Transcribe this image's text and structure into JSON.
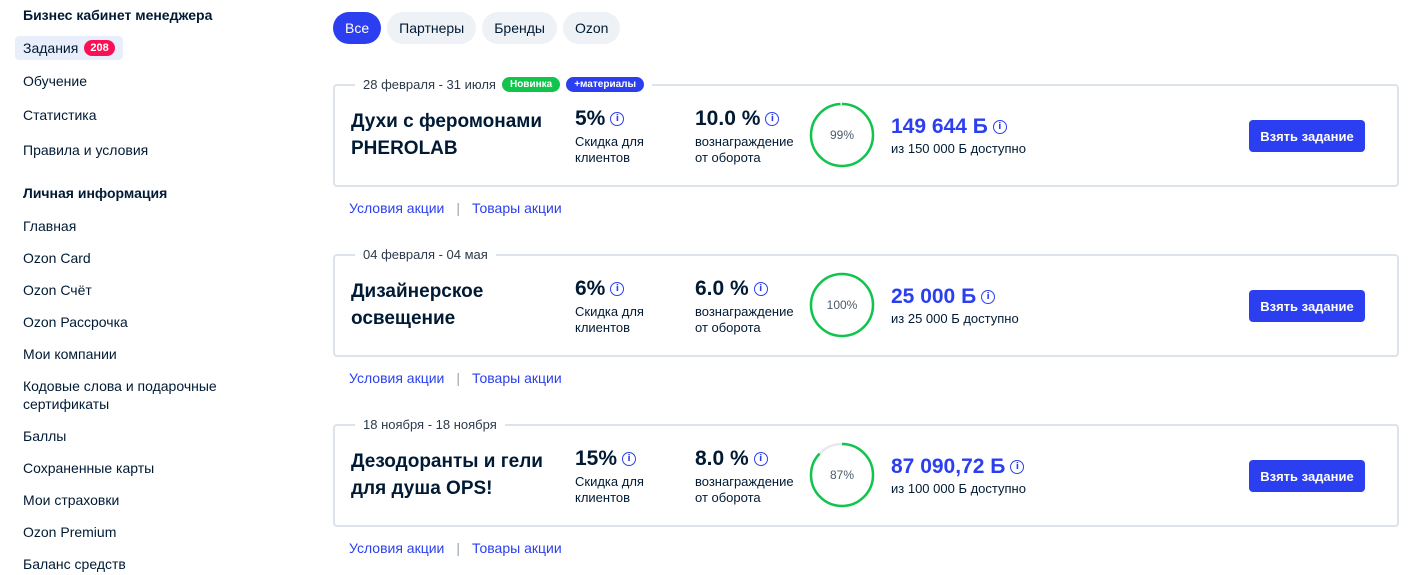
{
  "sidebar": {
    "section1_title": "Бизнес кабинет менеджера",
    "tasks": {
      "label": "Задания",
      "badge": "208"
    },
    "section1_items": [
      "Обучение",
      "Статистика",
      "Правила и условия"
    ],
    "section2_title": "Личная информация",
    "section2_items": [
      "Главная",
      "Ozon Card",
      "Ozon Счёт",
      "Ozon Рассрочка",
      "Мои компании",
      "Кодовые слова и подарочные сертификаты",
      "Баллы",
      "Сохраненные карты",
      "Мои страховки",
      "Ozon Premium",
      "Баланс средств"
    ]
  },
  "filters": [
    "Все",
    "Партнеры",
    "Бренды",
    "Ozon"
  ],
  "cards": [
    {
      "dates": "28 февраля - 31 июля",
      "tag_new": "Новинка",
      "tag_materials": "+материалы",
      "title": "Духи с феромонами PHEROLAB",
      "discount": "5%",
      "discount_label": "Скидка для клиентов",
      "reward": "10.0 %",
      "reward_label": "вознаграждение от оборота",
      "progress_label": "99%",
      "progress": 0.99,
      "budget": "149 644 Б",
      "budget_sub": "из 150 000 Б доступно",
      "button": "Взять задание",
      "link_terms": "Условия акции",
      "link_products": "Товары акции"
    },
    {
      "dates": "04 февраля - 04 мая",
      "tag_new": "",
      "tag_materials": "",
      "title": "Дизайнерское освещение",
      "discount": "6%",
      "discount_label": "Скидка для клиентов",
      "reward": "6.0 %",
      "reward_label": "вознаграждение от оборота",
      "progress_label": "100%",
      "progress": 1.0,
      "budget": "25 000 Б",
      "budget_sub": "из 25 000 Б доступно",
      "button": "Взять задание",
      "link_terms": "Условия акции",
      "link_products": "Товары акции"
    },
    {
      "dates": "18 ноября - 18 ноября",
      "tag_new": "",
      "tag_materials": "",
      "title": "Дезодоранты и гели для душа OPS!",
      "discount": "15%",
      "discount_label": "Скидка для клиентов",
      "reward": "8.0 %",
      "reward_label": "вознаграждение от оборота",
      "progress_label": "87%",
      "progress": 0.87,
      "budget": "87 090,72 Б",
      "budget_sub": "из 100 000 Б доступно",
      "button": "Взять задание",
      "link_terms": "Условия акции",
      "link_products": "Товары акции"
    }
  ],
  "colors": {
    "accent": "#2b3ff0",
    "progress": "#10c44c",
    "badge": "#f91155"
  }
}
